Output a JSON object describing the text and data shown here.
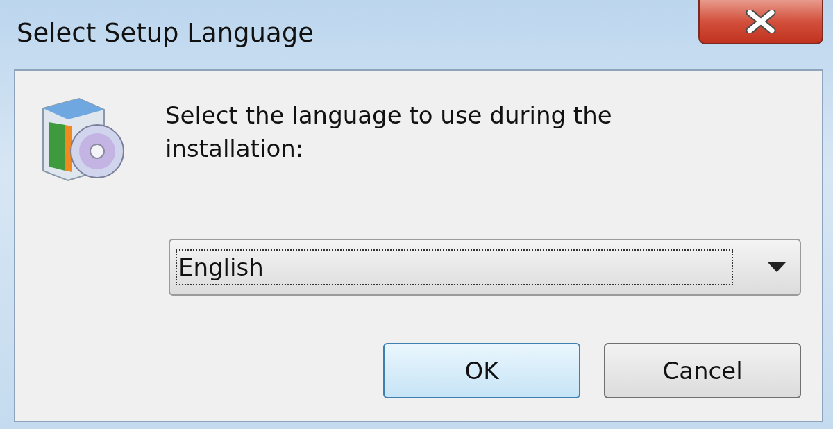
{
  "window": {
    "title": "Select Setup Language"
  },
  "message": "Select the language to use during the installation:",
  "language_select": {
    "value": "English",
    "focused": true
  },
  "buttons": [
    {
      "label": "OK",
      "default": true
    },
    {
      "label": "Cancel",
      "default": false
    }
  ]
}
